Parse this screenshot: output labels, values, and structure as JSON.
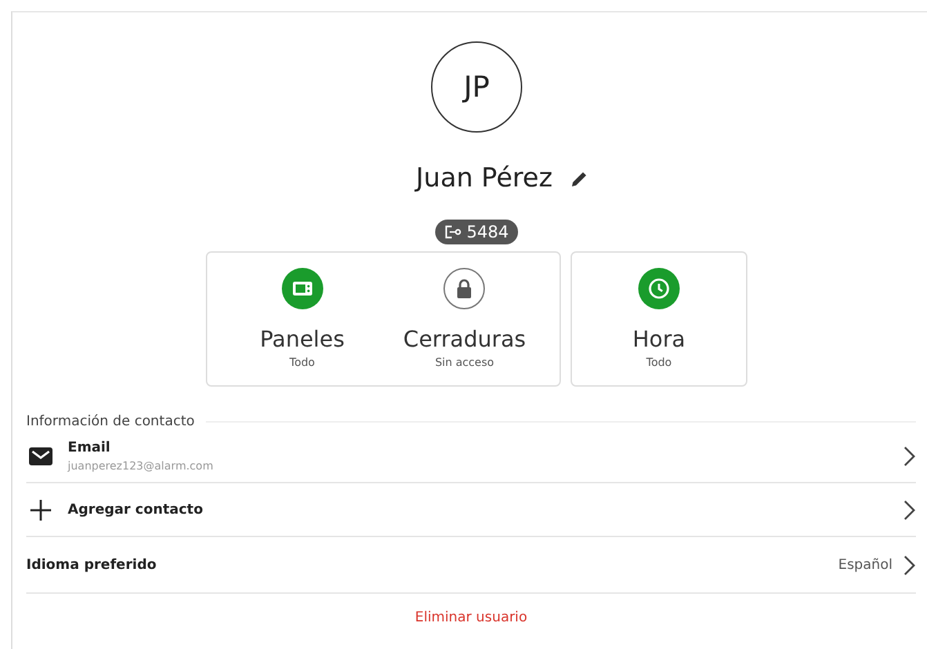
{
  "profile": {
    "initials": "JP",
    "name": "Juan Pérez",
    "badge": "5484"
  },
  "permission_cards": [
    {
      "items": [
        {
          "kind": "panel",
          "title": "Paneles",
          "subtitle": "Todo",
          "granted": true
        },
        {
          "kind": "lock",
          "title": "Cerraduras",
          "subtitle": "Sin acceso",
          "granted": false
        }
      ]
    },
    {
      "items": [
        {
          "kind": "clock",
          "title": "Hora",
          "subtitle": "Todo",
          "granted": true
        }
      ]
    }
  ],
  "contact": {
    "heading": "Información de contacto",
    "rows": [
      {
        "kind": "email",
        "label": "Email",
        "value": "juanperez123@alarm.com"
      },
      {
        "kind": "add",
        "label": "Agregar contacto"
      }
    ]
  },
  "language": {
    "label": "Idioma preferido",
    "value": "Español"
  },
  "delete_link": "Eliminar usuario"
}
